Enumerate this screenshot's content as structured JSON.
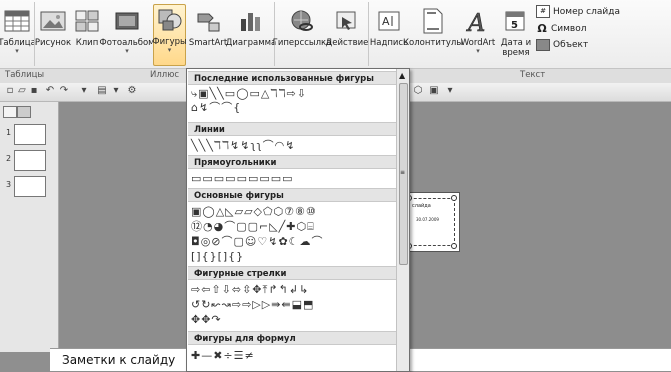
{
  "ribbon": {
    "buttons": [
      {
        "label": "Таблица"
      },
      {
        "label": "Рисунок"
      },
      {
        "label": "Клип"
      },
      {
        "label": "Фотоальбом"
      },
      {
        "label": "Фигуры"
      },
      {
        "label": "SmartArt"
      },
      {
        "label": "Диаграмма"
      },
      {
        "label": "Гиперссылка"
      },
      {
        "label": "Действие"
      },
      {
        "label": "Надпись"
      },
      {
        "label": "Колонтитулы"
      },
      {
        "label": "WordArt"
      },
      {
        "label": "Дата и время"
      }
    ],
    "small_buttons": [
      {
        "label": "Номер слайда"
      },
      {
        "label": "Символ"
      },
      {
        "label": "Объект"
      }
    ],
    "groups": {
      "tables": "Таблицы",
      "illustrations": "Иллюс",
      "text": "Текст"
    }
  },
  "gallery": {
    "sections": {
      "recent": "Последние использованные фигуры",
      "lines": "Линии",
      "rects": "Прямоугольники",
      "basic": "Основные фигуры",
      "arrows": "Фигурные стрелки",
      "formulas": "Фигуры для формул"
    },
    "rows": {
      "recent1": "⤷▣╲╲▭◯▭△ℸℸ⇨⇩",
      "recent2": "⌂↯⌒⌒{",
      "lines1": "╲╲╲ℸℸ↯↯ʅʅ⌒◠↯",
      "rects1": "▭▭▭▭▭▭▭▭▭",
      "basic1": "▣◯△◺▱▱◇⬠⬡⑦⑧⑩",
      "basic2": "⑫◔◕⌒▢▢⌐◺╱✚⬡⌸",
      "basic3": "◘◎⊘⌒▢☺♡↯✿☾☁⌒",
      "basic4": "[]{}[]{}",
      "arrows1": "⇨⇦⇧⇩⬄⇳✥⤒↱↰↲↳",
      "arrows2": "↺↻↜↝⇨⇨▷▷⇛⇚⬓⬒",
      "arrows3": "✥✥↷",
      "formulas1": "✚—✖÷☰≠"
    }
  },
  "slide": {
    "title_fragment": "слайда",
    "date_fragment": "30.07.2009"
  },
  "notes": {
    "placeholder": "Заметки к слайду"
  },
  "slides_pane": {
    "numbers": [
      "1",
      "2",
      "3"
    ]
  }
}
